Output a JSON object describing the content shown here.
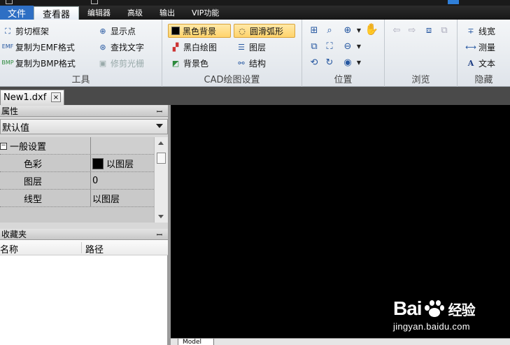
{
  "menu": {
    "tabs": [
      {
        "label": "文件"
      },
      {
        "label": "查看器"
      },
      {
        "label": "编辑器"
      },
      {
        "label": "高级"
      },
      {
        "label": "输出"
      },
      {
        "label": "VIP功能"
      }
    ]
  },
  "ribbon": {
    "tools": {
      "label": "工具",
      "buttons": [
        "剪切框架",
        "复制为EMF格式",
        "复制为BMP格式",
        "显示点",
        "查找文字",
        "修剪光栅"
      ]
    },
    "cad": {
      "label": "CAD绘图设置",
      "buttons": [
        "黑色背景",
        "黑白绘图",
        "背景色",
        "圆滑弧形",
        "图层",
        "结构"
      ]
    },
    "position": {
      "label": "位置"
    },
    "browse": {
      "label": "浏览"
    },
    "hide": {
      "label": "隐藏",
      "buttons": [
        "线宽",
        "测量",
        "文本"
      ]
    }
  },
  "document": {
    "tab": "New1.dxf",
    "close": "×"
  },
  "properties": {
    "title": "属性",
    "pin": "ꟷ",
    "dropdown": "默认值",
    "section": "一般设置",
    "expander": "−",
    "rows": [
      {
        "key": "色彩",
        "value": "以图层",
        "swatch": "#000000"
      },
      {
        "key": "图层",
        "value": "0"
      },
      {
        "key": "线型",
        "value": "以图层"
      }
    ]
  },
  "favorites": {
    "title": "收藏夹",
    "pin": "ꟷ",
    "columns": [
      "名称",
      "路径"
    ]
  },
  "layout_tab": "Model",
  "watermark": {
    "brand_left": "Bai",
    "brand_right": "经验",
    "url": "jingyan.baidu.com"
  },
  "colors": {
    "canvas": "#000000",
    "file_tab": "#2e6fc4",
    "highlight": "#ffd36b"
  }
}
